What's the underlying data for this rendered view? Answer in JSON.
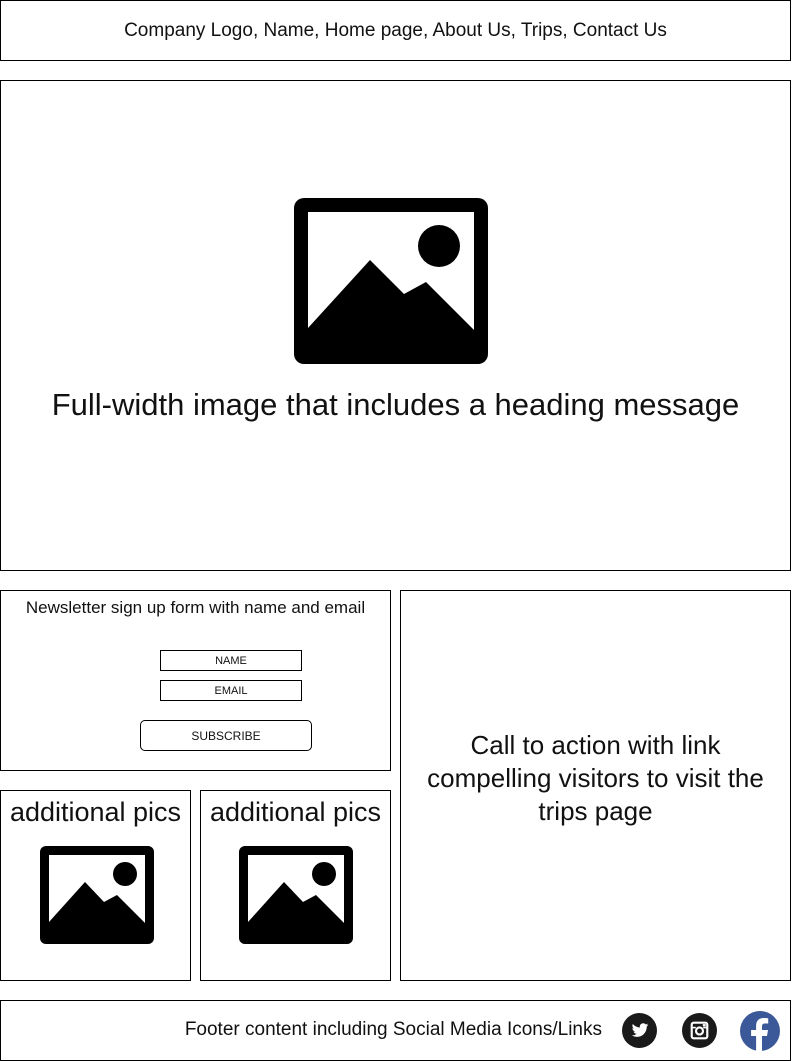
{
  "header": {
    "nav_text": "Company Logo, Name, Home page, About Us, Trips, Contact Us"
  },
  "hero": {
    "heading": "Full-width image that includes a heading message",
    "icon": "image-placeholder-icon"
  },
  "newsletter": {
    "title": "Newsletter sign up form with name and email",
    "name_placeholder": "NAME",
    "email_placeholder": "EMAIL",
    "subscribe_label": "SUBSCRIBE"
  },
  "cta": {
    "text": "Call to action with link compelling visitors to visit the trips page"
  },
  "pics": [
    {
      "label": "additional pics",
      "icon": "image-placeholder-icon"
    },
    {
      "label": "additional pics",
      "icon": "image-placeholder-icon"
    }
  ],
  "footer": {
    "text": "Footer content including Social Media Icons/Links",
    "social": [
      {
        "name": "twitter-icon",
        "color": "#1a1a1a"
      },
      {
        "name": "instagram-icon",
        "color": "#1a1a1a"
      },
      {
        "name": "facebook-icon",
        "color": "#3b5998"
      }
    ]
  }
}
